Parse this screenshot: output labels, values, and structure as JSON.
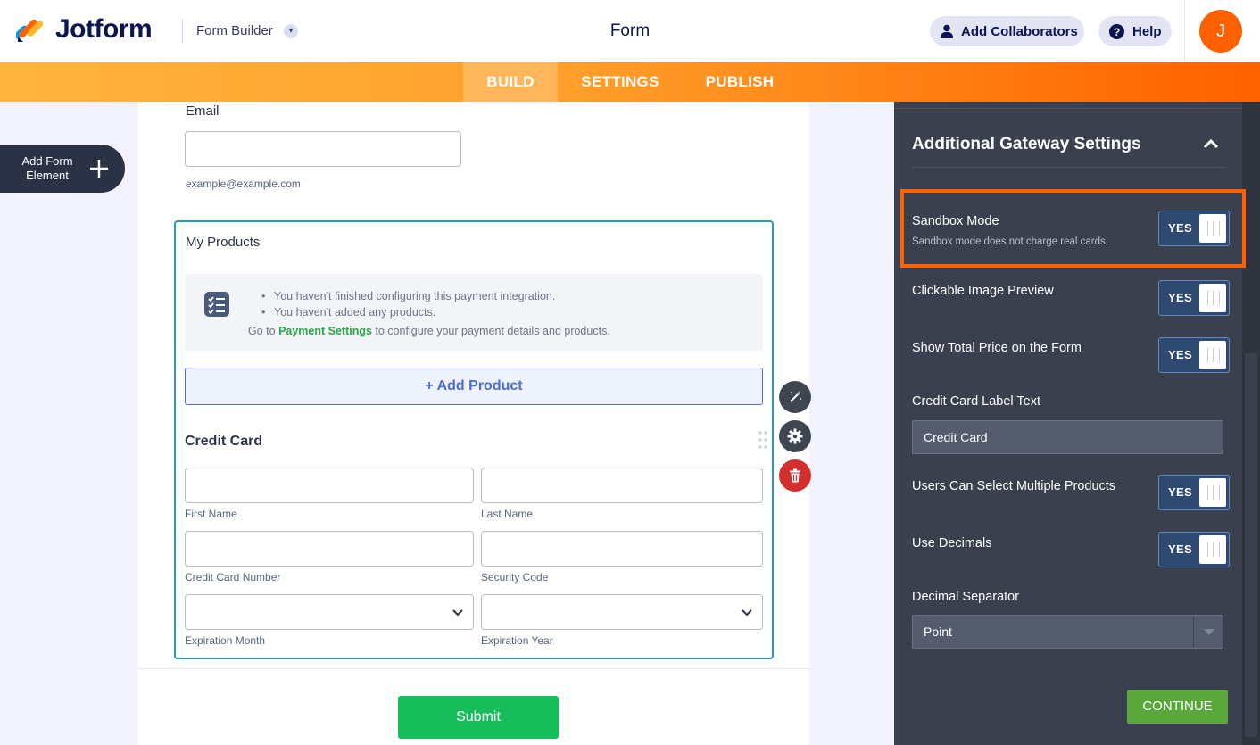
{
  "header": {
    "brand": "Jotform",
    "builder_label": "Form Builder",
    "title": "Form",
    "collaborators_label": "Add Collaborators",
    "help_label": "Help",
    "avatar_initial": "J"
  },
  "tabs": [
    {
      "label": "BUILD",
      "active": true
    },
    {
      "label": "SETTINGS",
      "active": false
    },
    {
      "label": "PUBLISH",
      "active": false
    }
  ],
  "sidebar": {
    "add_element_label_1": "Add Form",
    "add_element_label_2": "Element"
  },
  "form": {
    "email_label": "Email",
    "email_sublabel": "example@example.com",
    "products_label": "My Products",
    "notices": [
      "You haven't finished configuring this payment integration.",
      "You haven't added any products."
    ],
    "goto_prefix": "Go to",
    "goto_link": "Payment Settings",
    "goto_suffix": "to configure your payment details and products.",
    "add_product_label": "+ Add Product",
    "credit_card_title": "Credit Card",
    "first_name": "First Name",
    "last_name": "Last Name",
    "card_number": "Credit Card Number",
    "security_code": "Security Code",
    "exp_month": "Expiration Month",
    "exp_year": "Expiration Year",
    "submit_label": "Submit"
  },
  "panel": {
    "title": "Additional Gateway Settings",
    "sandbox_label": "Sandbox Mode",
    "sandbox_sub": "Sandbox mode does not charge real cards.",
    "sandbox_value": "YES",
    "clickable_label": "Clickable Image Preview",
    "clickable_value": "YES",
    "total_label": "Show Total Price on the Form",
    "total_value": "YES",
    "cc_label_text_label": "Credit Card Label Text",
    "cc_label_text_value": "Credit Card",
    "multi_label": "Users Can Select Multiple Products",
    "multi_value": "YES",
    "decimals_label": "Use Decimals",
    "decimals_value": "YES",
    "separator_label": "Decimal Separator",
    "separator_value": "Point",
    "continue_label": "CONTINUE"
  },
  "colors": {
    "brand_orange": "#ff6100",
    "panel_bg": "#3a404d",
    "submit_green": "#18bd5b",
    "continue_green": "#5aa83b",
    "link_green": "#2ba84a",
    "product_border": "#2b99bf"
  }
}
